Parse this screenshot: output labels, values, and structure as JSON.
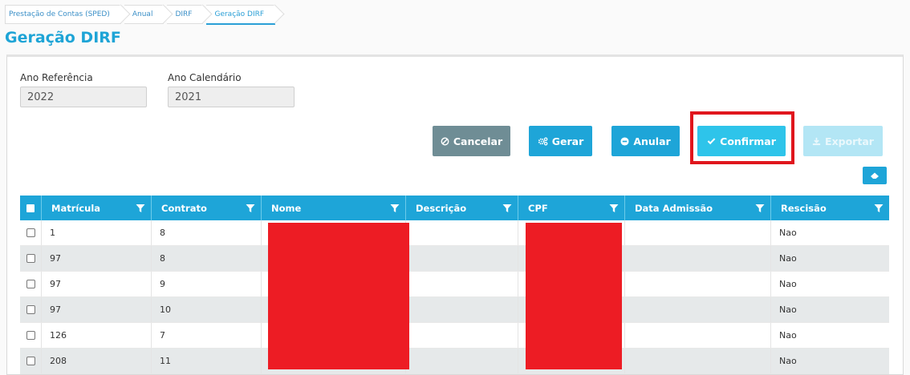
{
  "breadcrumb": [
    {
      "label": "Prestação de Contas (SPED)"
    },
    {
      "label": "Anual"
    },
    {
      "label": "DIRF"
    },
    {
      "label": "Geração DIRF"
    }
  ],
  "page": {
    "title": "Geração DIRF"
  },
  "form": {
    "ano_referencia": {
      "label": "Ano Referência",
      "value": "2022"
    },
    "ano_calendario": {
      "label": "Ano Calendário",
      "value": "2021"
    }
  },
  "actions": {
    "cancelar": "Cancelar",
    "gerar": "Gerar",
    "anular": "Anular",
    "confirmar": "Confirmar",
    "exportar": "Exportar"
  },
  "table": {
    "columns": [
      "Matrícula",
      "Contrato",
      "Nome",
      "Descrição",
      "CPF",
      "Data Admissão",
      "Rescisão"
    ],
    "rows": [
      {
        "matricula": "1",
        "contrato": "8",
        "nome": "",
        "descricao": "",
        "cpf": "",
        "data_admissao": "",
        "rescisao": "Nao"
      },
      {
        "matricula": "97",
        "contrato": "8",
        "nome": "",
        "descricao": "",
        "cpf": "",
        "data_admissao": "",
        "rescisao": "Nao"
      },
      {
        "matricula": "97",
        "contrato": "9",
        "nome": "",
        "descricao": "",
        "cpf": "",
        "data_admissao": "",
        "rescisao": "Nao"
      },
      {
        "matricula": "97",
        "contrato": "10",
        "nome": "",
        "descricao": "",
        "cpf": "",
        "data_admissao": "",
        "rescisao": "Nao"
      },
      {
        "matricula": "126",
        "contrato": "7",
        "nome": "",
        "descricao": "",
        "cpf": "",
        "data_admissao": "",
        "rescisao": "Nao"
      },
      {
        "matricula": "208",
        "contrato": "11",
        "nome": "",
        "descricao": "",
        "cpf": "",
        "data_admissao": "",
        "rescisao": "Nao"
      }
    ]
  },
  "colors": {
    "accent": "#1ea5d8",
    "highlight": "#e0161d",
    "redaction": "#ed1c24",
    "cancel": "#6f8d95"
  },
  "icons": {
    "cancelar": "ban-icon",
    "gerar": "gears-icon",
    "anular": "minus-circle-icon",
    "confirmar": "check-icon",
    "exportar": "download-icon",
    "clear": "eraser-icon",
    "filter": "filter-icon"
  }
}
